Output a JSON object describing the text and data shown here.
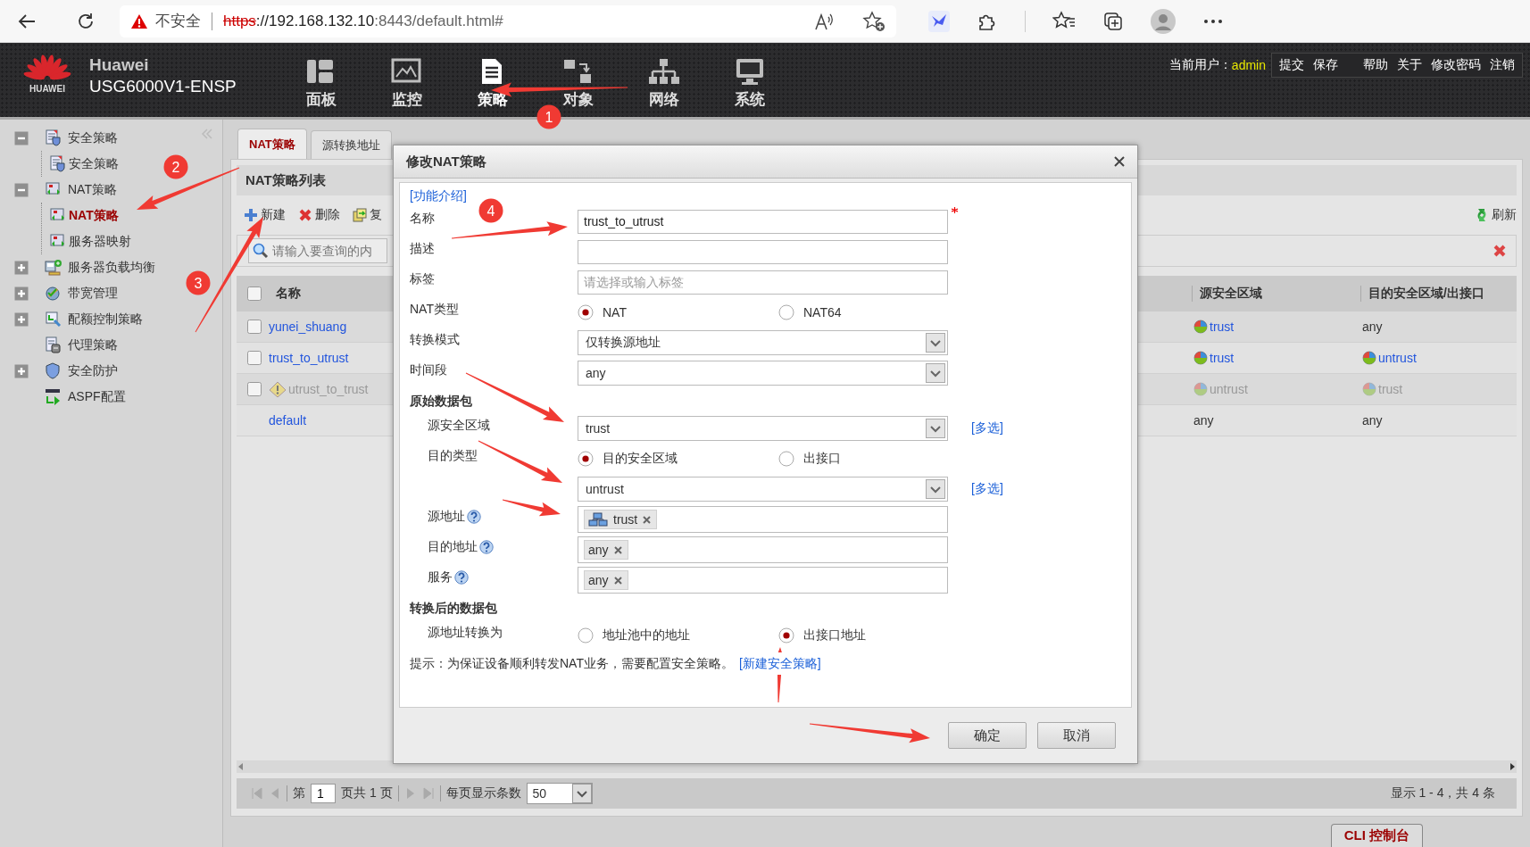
{
  "browser": {
    "security": "不安全",
    "url_scheme": "https",
    "url_host": "://192.168.132.10",
    "url_rest": ":8443/default.html#"
  },
  "header": {
    "logo_text": "HUAWEI",
    "brand": "Huawei",
    "model": "USG6000V1-ENSP",
    "nav": [
      {
        "label": "面板",
        "selected": false
      },
      {
        "label": "监控",
        "selected": false
      },
      {
        "label": "策略",
        "selected": true
      },
      {
        "label": "对象",
        "selected": false
      },
      {
        "label": "网络",
        "selected": false
      },
      {
        "label": "系统",
        "selected": false
      }
    ],
    "user_label": "当前用户：",
    "user": "admin",
    "actions": [
      "提交",
      "保存",
      "帮助",
      "关于",
      "修改密码",
      "注销"
    ]
  },
  "sidebar": {
    "items": [
      {
        "label": "安全策略",
        "selected": false,
        "expanded": true,
        "children": [
          {
            "label": "安全策略",
            "selected": false
          }
        ]
      },
      {
        "label": "NAT策略",
        "selected": false,
        "expanded": true,
        "children": [
          {
            "label": "NAT策略",
            "selected": true
          },
          {
            "label": "服务器映射",
            "selected": false
          }
        ]
      },
      {
        "label": "服务器负载均衡",
        "selected": false,
        "expanded": false
      },
      {
        "label": "带宽管理",
        "selected": false,
        "expanded": false
      },
      {
        "label": "配额控制策略",
        "selected": false,
        "expanded": false
      },
      {
        "label": "代理策略",
        "selected": false
      },
      {
        "label": "安全防护",
        "selected": false,
        "expanded": false
      },
      {
        "label": "ASPF配置",
        "selected": false
      }
    ]
  },
  "tabs": [
    {
      "label": "NAT策略",
      "selected": true
    },
    {
      "label": "源转换地址",
      "selected": false
    }
  ],
  "panel_title": "NAT策略列表",
  "toolbar": [
    "新建",
    "删除",
    "复"
  ],
  "refresh": "刷新",
  "search": {
    "placeholder": "请输入要查询的内"
  },
  "table": {
    "all_checked": false,
    "columns": [
      "名称",
      "源安全区域",
      "目的安全区域/出接口"
    ],
    "rows": [
      {
        "kind": "policy",
        "checked": false,
        "enabled": true,
        "name": "yunei_shuang",
        "source": {
          "text": "trust",
          "zone": true
        },
        "destination": {
          "text": "any",
          "zone": false
        }
      },
      {
        "kind": "policy",
        "checked": false,
        "enabled": true,
        "name": "trust_to_utrust",
        "source": {
          "text": "trust",
          "zone": true
        },
        "destination": {
          "text": "untrust",
          "zone": true
        }
      },
      {
        "kind": "policy",
        "checked": false,
        "enabled": false,
        "name": "utrust_to_trust",
        "source": {
          "text": "untrust",
          "zone": true
        },
        "destination": {
          "text": "trust",
          "zone": true
        }
      },
      {
        "kind": "default",
        "enabled": true,
        "name": "default",
        "source": {
          "text": "any",
          "zone": false
        },
        "destination": {
          "text": "any",
          "zone": false
        }
      }
    ]
  },
  "pager": {
    "page_prefix": "第",
    "page": "1",
    "page_suffix": "页共 1 页",
    "per_page_label": "每页显示条数",
    "per_page": "50",
    "summary": "显示 1 - 4，共 4 条"
  },
  "cli_button": "CLI 控制台",
  "dialog": {
    "title": "修改NAT策略",
    "help_link": "[功能介绍]",
    "fields": [
      {
        "kind": "text",
        "label": "名称",
        "value": "trust_to_utrust",
        "required": true
      },
      {
        "kind": "text",
        "label": "描述",
        "required": false
      },
      {
        "kind": "text",
        "label": "标签",
        "placeholder": "请选择或输入标签",
        "required": false
      },
      {
        "kind": "radio",
        "label": "NAT类型",
        "options": [
          {
            "label": "NAT",
            "selected": true
          },
          {
            "label": "NAT64",
            "selected": false
          }
        ]
      },
      {
        "kind": "select",
        "label": "转换模式",
        "value": "仅转换源地址"
      },
      {
        "kind": "select",
        "label": "时间段",
        "value": "any"
      },
      {
        "kind": "section",
        "label": "原始数据包",
        "children": [
          {
            "kind": "select",
            "label": "源安全区域",
            "value": "trust",
            "link": "[多选]"
          },
          {
            "kind": "radio",
            "label": "目的类型",
            "options": [
              {
                "label": "目的安全区域",
                "selected": true
              },
              {
                "label": "出接口",
                "selected": false
              }
            ]
          },
          {
            "kind": "select",
            "value": "untrust",
            "link": "[多选]"
          },
          {
            "kind": "tags",
            "label": "源地址",
            "help": true,
            "tags": [
              {
                "text": "trust",
                "icon": true
              }
            ]
          },
          {
            "kind": "tags",
            "label": "目的地址",
            "help": true,
            "tags": [
              {
                "text": "any",
                "icon": false
              }
            ]
          },
          {
            "kind": "tags",
            "label": "服务",
            "help": true,
            "tags": [
              {
                "text": "any",
                "icon": false
              }
            ]
          }
        ]
      },
      {
        "kind": "section",
        "label": "转换后的数据包",
        "children": [
          {
            "kind": "radio",
            "label": "源地址转换为",
            "options": [
              {
                "label": "地址池中的地址",
                "selected": false
              },
              {
                "label": "出接口地址",
                "selected": true
              }
            ]
          }
        ]
      }
    ],
    "hint": "提示：为保证设备顺利转发NAT业务，需要配置安全策略。",
    "hint_link": "[新建安全策略]",
    "buttons": [
      "确定",
      "取消"
    ]
  },
  "annotations": {
    "step_badges": [
      "1",
      "2",
      "3",
      "4"
    ]
  }
}
